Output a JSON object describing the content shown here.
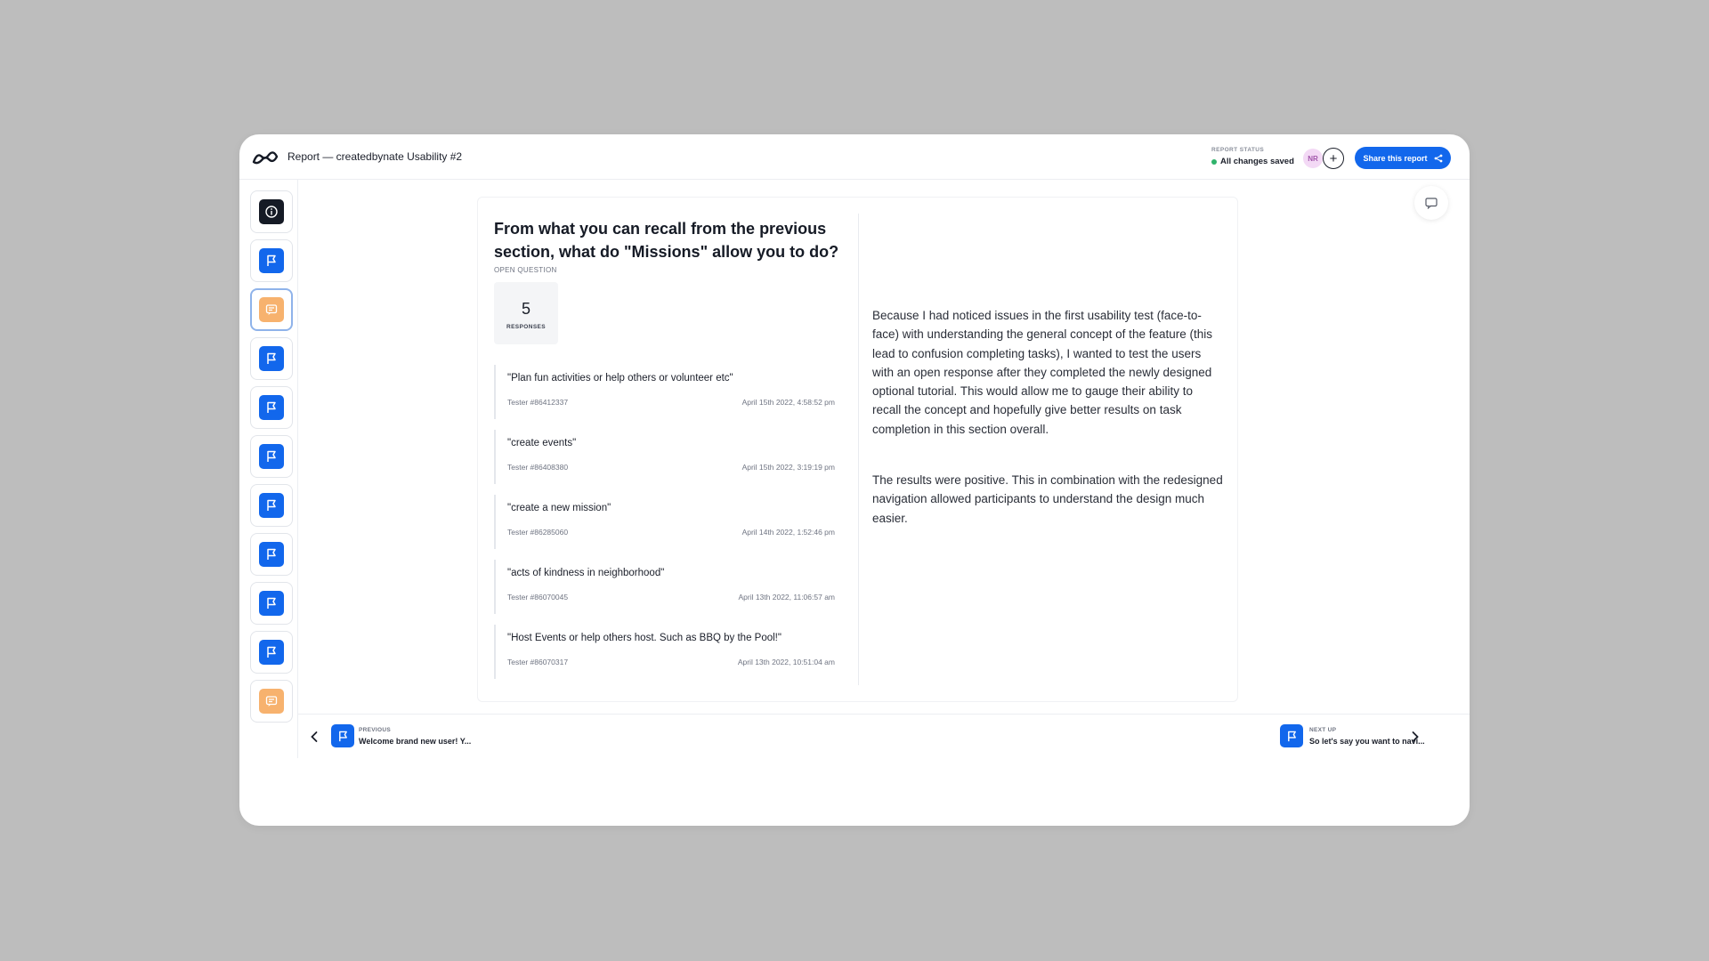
{
  "header": {
    "title": "Report — createdbynate Usability #2",
    "status_label": "REPORT STATUS",
    "status_value": "All changes saved",
    "avatar_initials": "NR",
    "add_member": "+",
    "share_label": "Share this report"
  },
  "sidebar": {
    "items": [
      {
        "icon": "info-icon",
        "color": "dark"
      },
      {
        "icon": "flag-icon",
        "color": "blue"
      },
      {
        "icon": "comment-icon",
        "color": "orange",
        "active": true
      },
      {
        "icon": "flag-icon",
        "color": "blue"
      },
      {
        "icon": "flag-icon",
        "color": "blue"
      },
      {
        "icon": "flag-icon",
        "color": "blue"
      },
      {
        "icon": "flag-icon",
        "color": "blue"
      },
      {
        "icon": "flag-icon",
        "color": "blue"
      },
      {
        "icon": "flag-icon",
        "color": "blue"
      },
      {
        "icon": "flag-icon",
        "color": "blue"
      },
      {
        "icon": "comment-icon",
        "color": "orange"
      }
    ]
  },
  "question": {
    "title": "From what you can recall from the previous section, what do \"Missions\" allow you to do?",
    "type": "OPEN QUESTION",
    "response_count": "5",
    "response_label": "RESPONSES"
  },
  "answers": [
    {
      "text": "\"Plan fun activities or help others or volunteer etc\"",
      "tester": "Tester #86412337",
      "date": "April 15th 2022, 4:58:52 pm"
    },
    {
      "text": "\"create events\"",
      "tester": "Tester #86408380",
      "date": "April 15th 2022, 3:19:19 pm"
    },
    {
      "text": "\"create a new mission\"",
      "tester": "Tester #86285060",
      "date": "April 14th 2022, 1:52:46 pm"
    },
    {
      "text": "\"acts of kindness in neighborhood\"",
      "tester": "Tester #86070045",
      "date": "April 13th 2022, 11:06:57 am"
    },
    {
      "text": "\"Host Events or help others host. Such as BBQ by the Pool!\"",
      "tester": "Tester #86070317",
      "date": "April 13th 2022, 10:51:04 am"
    }
  ],
  "notes": [
    "Because I had noticed issues in the first usability test (face-to-face) with understanding the general concept of the feature (this lead to confusion completing tasks), I wanted to test the users with an open response after they completed the newly designed optional tutorial. This would allow me to gauge their ability to recall the concept and hopefully give better results on task completion in this section overall.",
    "The results were positive. This in combination with the redesigned navigation allowed participants to understand the design much easier."
  ],
  "footer": {
    "previous_label": "PREVIOUS",
    "previous_text": "Welcome brand new user! Y...",
    "next_label": "NEXT UP",
    "next_text": "So let's say you want to navi..."
  },
  "colors": {
    "accent": "#1267ec",
    "orange": "#f7b26e",
    "dark": "#151a25",
    "saved": "#2fb36b"
  }
}
